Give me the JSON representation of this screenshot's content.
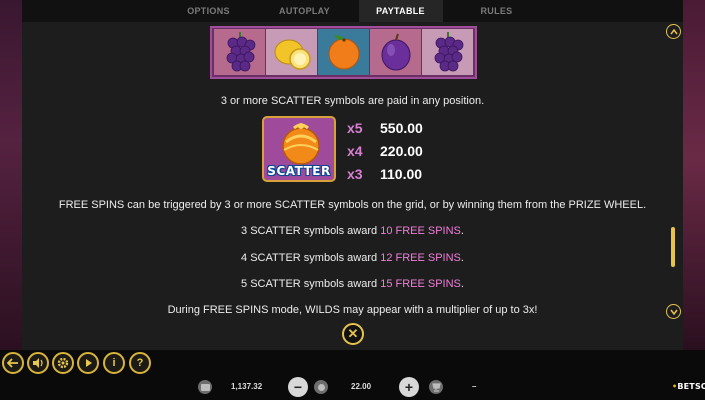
{
  "tabs": [
    {
      "label": "OPTIONS",
      "active": false
    },
    {
      "label": "AUTOPLAY",
      "active": false
    },
    {
      "label": "PAYTABLE",
      "active": true
    },
    {
      "label": "RULES",
      "active": false
    }
  ],
  "reel_symbols": [
    "grapes-icon",
    "lemon-icon",
    "orange-icon",
    "plum-icon",
    "grapes-icon"
  ],
  "scatter_info": "3 or more SCATTER symbols are paid in any position.",
  "scatter_symbol_label": "SCATTER",
  "payouts": [
    {
      "mult": "x5",
      "value": "550.00"
    },
    {
      "mult": "x4",
      "value": "220.00"
    },
    {
      "mult": "x3",
      "value": "110.00"
    }
  ],
  "free_spins_intro": "FREE SPINS can be triggered by 3 or more SCATTER symbols on the grid, or by winning them from the PRIZE WHEEL.",
  "awards": [
    {
      "prefix": "3 SCATTER symbols award ",
      "highlight": "10 FREE SPINS",
      "suffix": "."
    },
    {
      "prefix": "4 SCATTER symbols award ",
      "highlight": "12 FREE SPINS",
      "suffix": "."
    },
    {
      "prefix": "5 SCATTER symbols award ",
      "highlight": "15 FREE SPINS",
      "suffix": "."
    }
  ],
  "wilds_note": "During FREE SPINS mode, WILDS may appear with a multiplier of up to 3x!",
  "controls": {
    "close_symbol": "✕",
    "info_symbol": "i",
    "help_symbol": "?"
  },
  "status_bar": {
    "balance": "1,137.32",
    "bet": "22.00",
    "win": "–",
    "minus": "−",
    "plus": "+"
  },
  "brand": {
    "prefix": "•",
    "name": "BETSOFT"
  },
  "colors": {
    "accent_gold": "#e6c34a",
    "highlight_pink": "#f07ed8",
    "multiplier_pink": "#d97fd3",
    "panel_bg": "#1d1d1d"
  }
}
